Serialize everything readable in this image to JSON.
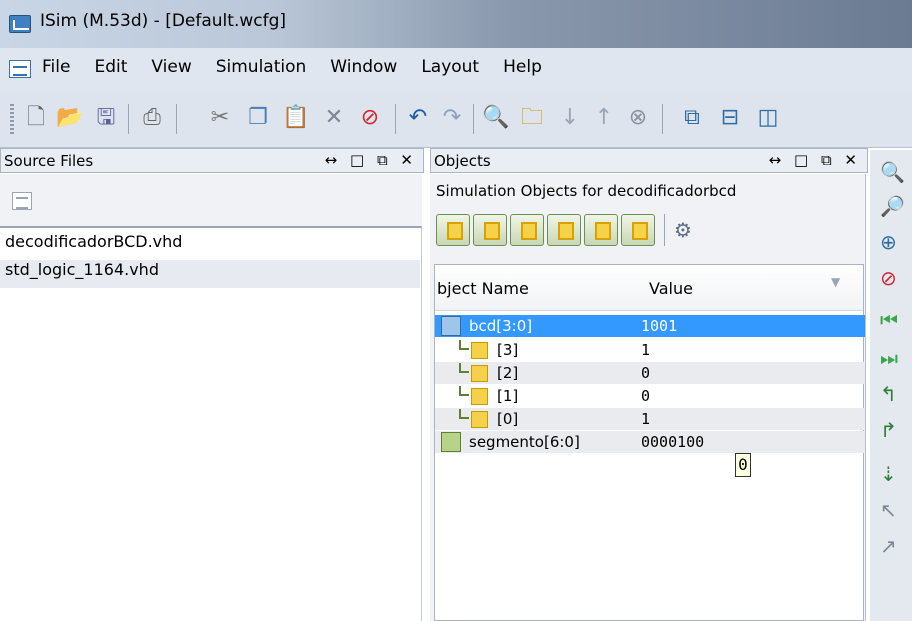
{
  "window": {
    "title": "ISim (M.53d) - [Default.wcfg]"
  },
  "menu": {
    "items": [
      {
        "label": "File"
      },
      {
        "label": "Edit"
      },
      {
        "label": "View"
      },
      {
        "label": "Simulation"
      },
      {
        "label": "Window"
      },
      {
        "label": "Layout"
      },
      {
        "label": "Help"
      }
    ]
  },
  "toolbar": {
    "icons": [
      "new-file-icon",
      "open-folder-icon",
      "save-icon",
      "print-icon",
      "cut-icon",
      "copy-icon",
      "paste-icon",
      "delete-icon",
      "stop-icon",
      "undo-icon",
      "redo-icon",
      "find-icon",
      "find-in-files-icon",
      "move-down-icon",
      "move-up-icon",
      "clear-icon",
      "tile-icon",
      "horizontal-split-icon",
      "vertical-split-icon"
    ]
  },
  "source_panel": {
    "title": "Source Files",
    "controls": "↔ □ ⧉ ✕",
    "files": [
      "decodificadorBCD.vhd",
      "std_logic_1164.vhd"
    ]
  },
  "objects_panel": {
    "title": "Objects",
    "controls": "↔ □ ⧉ ✕",
    "subtitle": "Simulation Objects for decodificadorbcd",
    "columns": {
      "name": "bject Name",
      "value": "Value"
    },
    "rows": [
      {
        "name": "bcd[3:0]",
        "value": "1001"
      },
      {
        "name": "[3]",
        "value": "1"
      },
      {
        "name": "[2]",
        "value": "0"
      },
      {
        "name": "[1]",
        "value": "0"
      },
      {
        "name": "[0]",
        "value": "1"
      },
      {
        "name": "segmento[6:0]",
        "value": "0000100"
      }
    ],
    "tooltip": "0"
  },
  "colors": {
    "selection": "#3399ff",
    "accent": "#3a6fb0"
  }
}
